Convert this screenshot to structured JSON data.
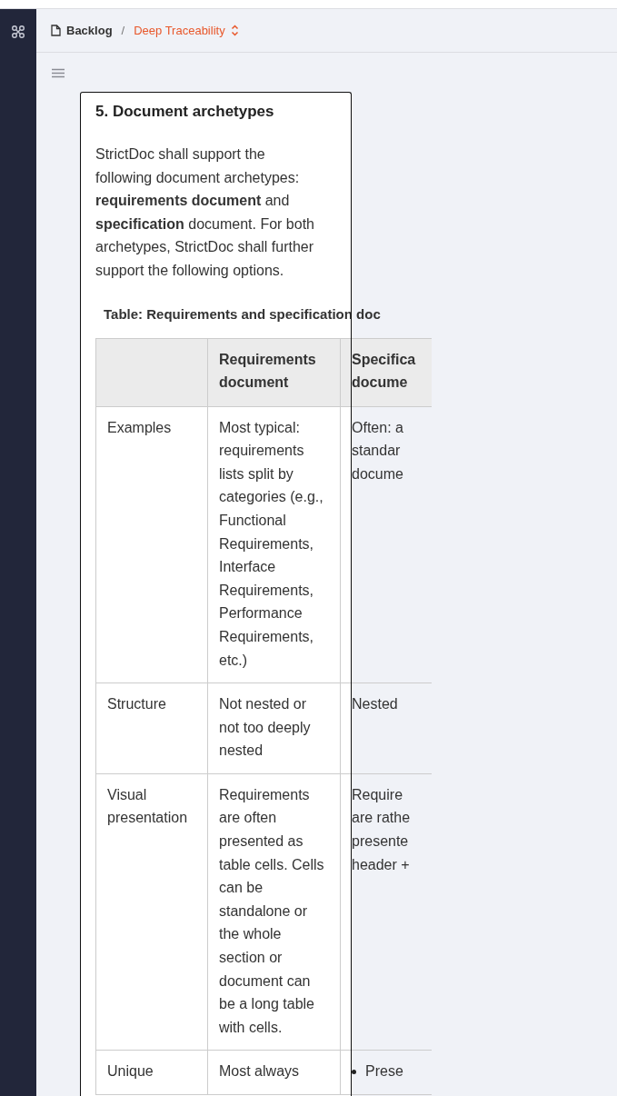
{
  "breadcrumbs": [
    {
      "label": "Backlog",
      "kind": "file"
    },
    {
      "label": "Deep Traceability",
      "kind": "current"
    }
  ],
  "breadcrumb_separator": "/",
  "section": {
    "title": "5. Document archetypes",
    "paragraph": "StrictDoc shall support the following document archetypes: **requirements document** and **specification** document. For both archetypes, StrictDoc shall further support the following options."
  },
  "table": {
    "caption": "Table: Requirements and specification doc",
    "columns": [
      "",
      "Requirements document",
      "Specifica\ndocume"
    ],
    "rows": [
      {
        "cells": [
          "Examples",
          "Most typical: requirements lists split by categories (e.g., Functional Requirements, Interface Requirements, Performance Requirements, etc.)",
          "Often: a\nstandar\ndocume"
        ],
        "list": false
      },
      {
        "cells": [
          "Structure",
          "Not nested or not too deeply nested",
          "Nested"
        ],
        "list": false
      },
      {
        "cells": [
          "Visual presentation",
          "Requirements are often presented as table cells. Cells can be standalone or the whole section or document can be a long table with cells.",
          "Require\nare rathe\npresente\nheader +"
        ],
        "list": false
      },
      {
        "cells": [
          "Unique",
          "Most always",
          "Prese"
        ],
        "list": true
      }
    ]
  }
}
